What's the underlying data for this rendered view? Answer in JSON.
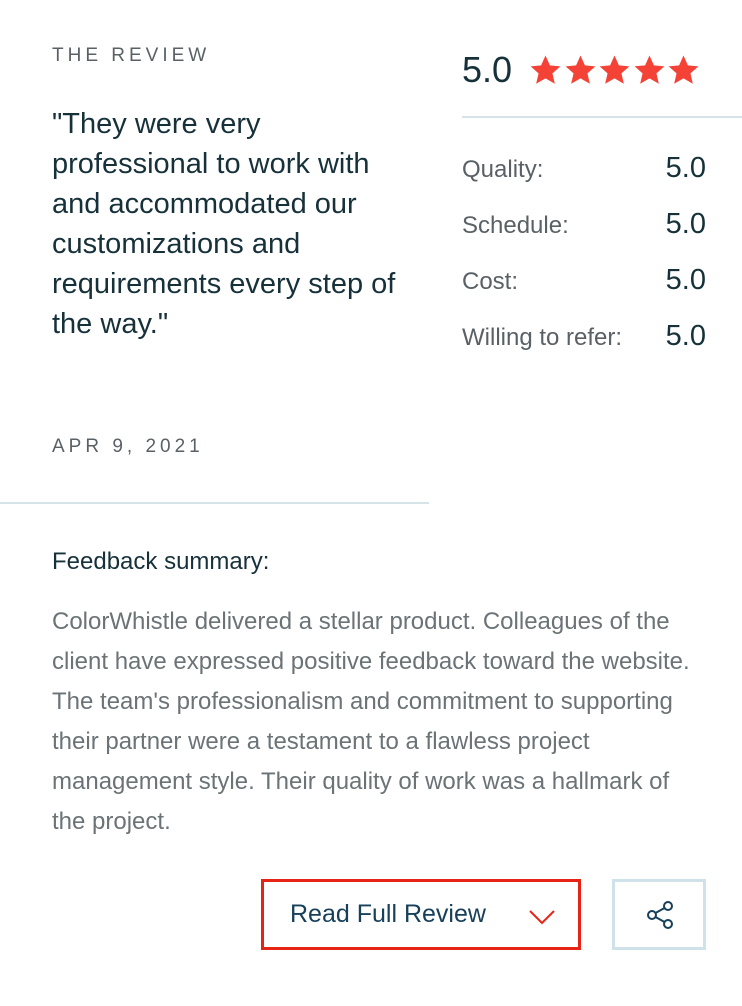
{
  "review": {
    "section_label": "THE REVIEW",
    "quote": "\"They were very professional to work with and accommodated our customizations and requirements every step of the way.\"",
    "date": "APR 9, 2021"
  },
  "rating": {
    "overall": "5.0",
    "stars": 5,
    "star_color": "#f44336",
    "breakdown": [
      {
        "label": "Quality:",
        "value": "5.0"
      },
      {
        "label": "Schedule:",
        "value": "5.0"
      },
      {
        "label": "Cost:",
        "value": "5.0"
      },
      {
        "label": "Willing to refer:",
        "value": "5.0"
      }
    ]
  },
  "feedback": {
    "heading": "Feedback summary:",
    "body": "ColorWhistle delivered a stellar product. Colleagues of the client have expressed positive feedback toward the website. The team's professionalism and commitment to supporting their partner were a testament to a flawless project management style. Their quality of work was a hallmark of the project."
  },
  "actions": {
    "read_full_review": "Read Full Review",
    "read_icon": "chevron-down-icon",
    "share_icon": "share-icon",
    "highlight_color": "#e62415"
  }
}
